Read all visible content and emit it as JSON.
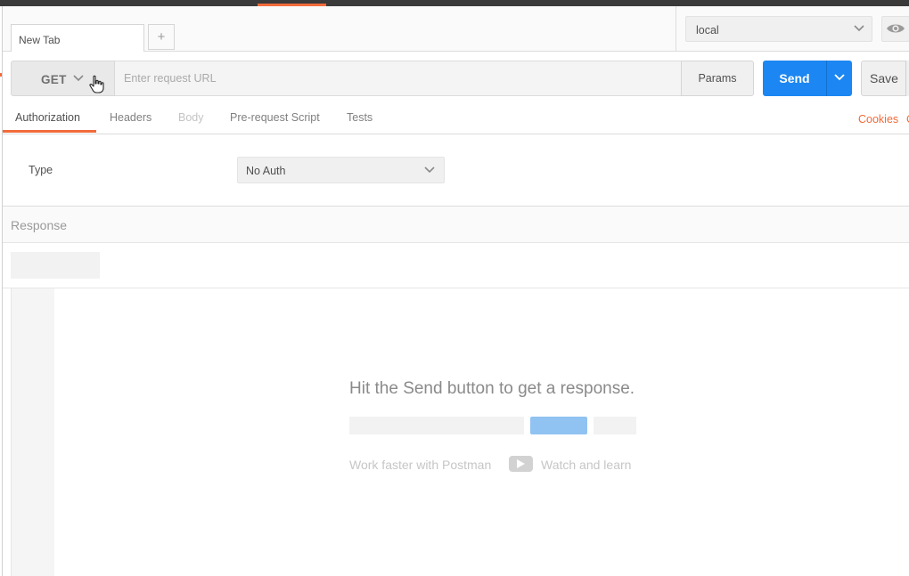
{
  "tabs": {
    "current_tab_label": "New Tab",
    "new_tab_symbol": "+"
  },
  "environment": {
    "selected": "local"
  },
  "request": {
    "method": "GET",
    "url_value": "",
    "url_placeholder": "Enter request URL",
    "params_label": "Params",
    "send_label": "Send",
    "save_label": "Save"
  },
  "request_tabs": [
    {
      "label": "Authorization",
      "state": "active"
    },
    {
      "label": "Headers",
      "state": "normal"
    },
    {
      "label": "Body",
      "state": "disabled"
    },
    {
      "label": "Pre-request Script",
      "state": "normal"
    },
    {
      "label": "Tests",
      "state": "normal"
    }
  ],
  "links": {
    "cookies": "Cookies",
    "code_partial": "C"
  },
  "auth": {
    "type_label": "Type",
    "type_value": "No Auth"
  },
  "response": {
    "title": "Response",
    "empty_message": "Hit the Send button to get a response.",
    "promo_text": "Work faster with Postman",
    "promo_link": "Watch and learn"
  },
  "colors": {
    "accent": "#f26b3a",
    "send_blue": "#1c86f2"
  }
}
